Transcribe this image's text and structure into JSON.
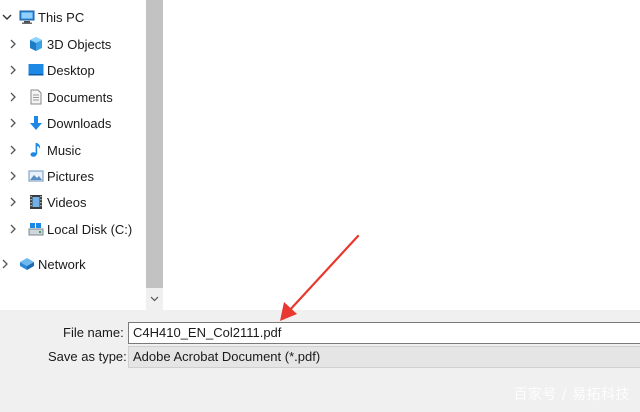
{
  "nav": {
    "this_pc": "This PC",
    "items": [
      {
        "label": "3D Objects",
        "icon": "3d-objects-icon"
      },
      {
        "label": "Desktop",
        "icon": "desktop-icon"
      },
      {
        "label": "Documents",
        "icon": "documents-icon"
      },
      {
        "label": "Downloads",
        "icon": "downloads-icon"
      },
      {
        "label": "Music",
        "icon": "music-icon"
      },
      {
        "label": "Pictures",
        "icon": "pictures-icon"
      },
      {
        "label": "Videos",
        "icon": "videos-icon"
      },
      {
        "label": "Local Disk (C:)",
        "icon": "local-disk-icon"
      }
    ],
    "network": "Network"
  },
  "save_dialog": {
    "file_name_label": "File name:",
    "file_name_value": "C4H410_EN_Col2111.pdf",
    "save_as_type_label": "Save as type:",
    "save_as_type_value": "Adobe Acrobat Document (*.pdf)"
  },
  "watermark": "百家号 / 易拓科技",
  "colors": {
    "annotation_arrow": "#e8382f",
    "panel_bg": "#f0f0f0",
    "scroll_thumb": "#c2c2c2",
    "icon_blue": "#1e88e5"
  }
}
